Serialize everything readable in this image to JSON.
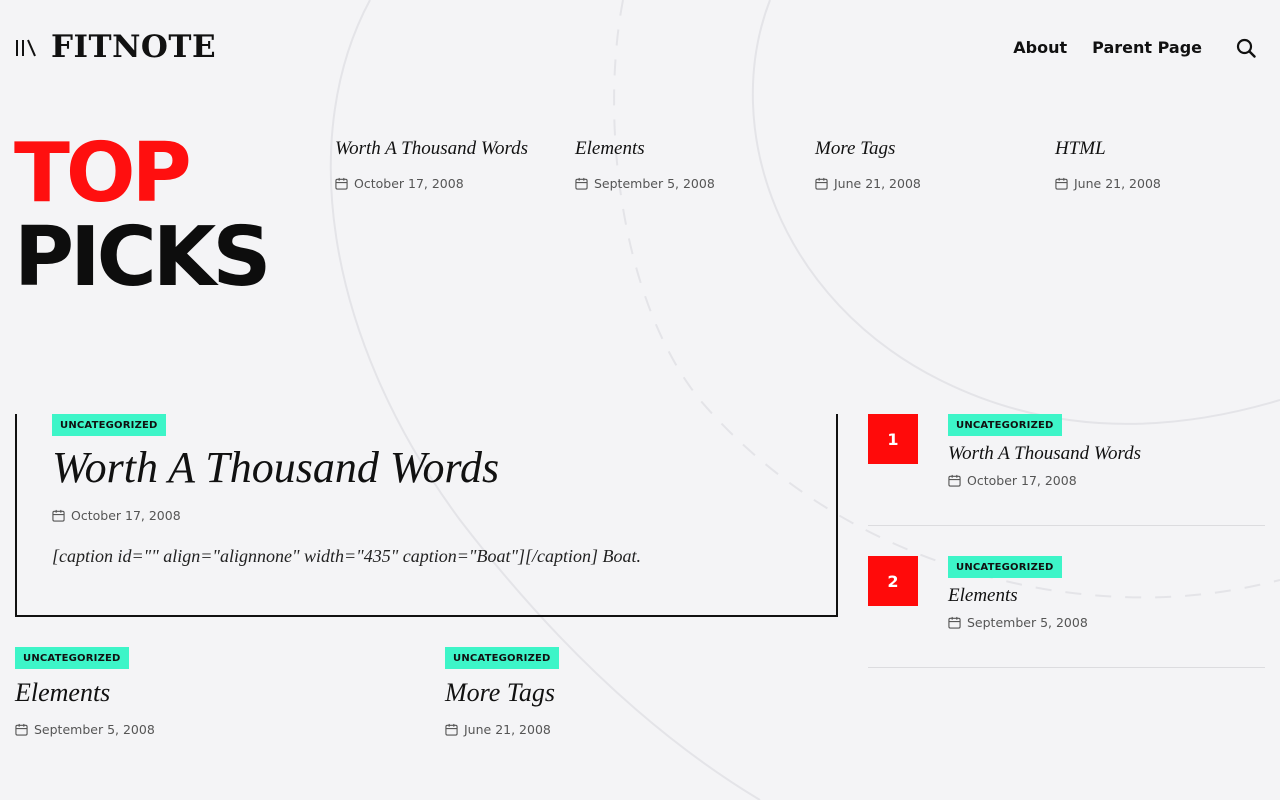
{
  "site": {
    "logo": "FITNOTE"
  },
  "nav": {
    "items": [
      "About",
      "Parent Page"
    ]
  },
  "hero": {
    "line1": "TOP",
    "line2": "PICKS"
  },
  "top_picks": [
    {
      "title": "Worth A Thousand Words",
      "date": "October 17, 2008"
    },
    {
      "title": "Elements",
      "date": "September 5, 2008"
    },
    {
      "title": "More Tags",
      "date": "June 21, 2008"
    },
    {
      "title": "HTML",
      "date": "June 21, 2008"
    }
  ],
  "featured": {
    "category": "UNCATEGORIZED",
    "title": "Worth A Thousand Words",
    "date": "October 17, 2008",
    "excerpt": "[caption id=\"\" align=\"alignnone\" width=\"435\" caption=\"Boat\"][/caption] Boat."
  },
  "cards": [
    {
      "category": "UNCATEGORIZED",
      "title": "Elements",
      "date": "September 5, 2008"
    },
    {
      "category": "UNCATEGORIZED",
      "title": "More Tags",
      "date": "June 21, 2008"
    }
  ],
  "ranked": [
    {
      "rank": "1",
      "category": "UNCATEGORIZED",
      "title": "Worth A Thousand Words",
      "date": "October 17, 2008"
    },
    {
      "rank": "2",
      "category": "UNCATEGORIZED",
      "title": "Elements",
      "date": "September 5, 2008"
    }
  ],
  "colors": {
    "accent_red": "#ff0f0f",
    "badge_teal": "#3df5c8",
    "background": "#f4f4f6"
  },
  "icons": {
    "menu": "menu-icon",
    "search": "search-icon",
    "date": "calendar-icon"
  }
}
